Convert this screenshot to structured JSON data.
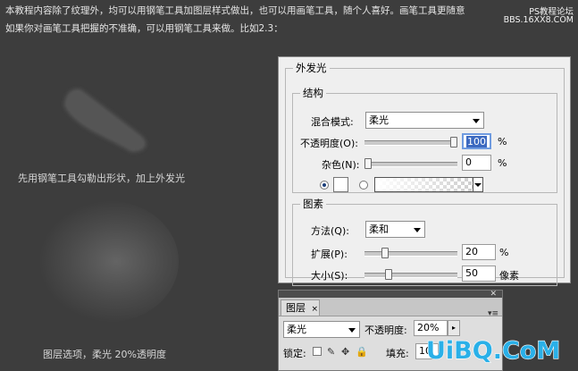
{
  "intro": {
    "line1": "本教程内容除了纹理外，均可以用钢笔工具加图层样式做出，也可以用画笔工具，随个人喜好。画笔工具更随意",
    "line2": "如果你对画笔工具把握的不准确，可以用钢笔工具来做。比如2.3："
  },
  "watermark": {
    "line1": "PS教程论坛",
    "line2": "BBS.16XX8.COM"
  },
  "captions": {
    "shape": "先用钢笔工具勾勒出形状，加上外发光",
    "layer": "图层选项，柔光 20%透明度"
  },
  "outer_glow": {
    "title": "外发光",
    "structure": {
      "legend": "结构",
      "blend_label": "混合模式:",
      "blend_value": "柔光",
      "opacity_label": "不透明度(O):",
      "opacity_value": "100",
      "opacity_unit": "%",
      "opacity_fraction": 1.0,
      "noise_label": "杂色(N):",
      "noise_value": "0",
      "noise_unit": "%",
      "noise_fraction": 0.0
    },
    "elements": {
      "legend": "图素",
      "method_label": "方法(Q):",
      "method_value": "柔和",
      "spread_label": "扩展(P):",
      "spread_value": "20",
      "spread_unit": "%",
      "spread_fraction": 0.2,
      "size_label": "大小(S):",
      "size_value": "50",
      "size_unit": "像素"
    }
  },
  "layers_panel": {
    "tab": "图层",
    "tab_close": "×",
    "menu": "▾≡",
    "blend_value": "柔光",
    "opacity_label": "不透明度:",
    "opacity_value": "20%",
    "lock_label": "锁定:",
    "fill_label": "填充:",
    "fill_value": "10"
  },
  "brand_logo": "UiBQ.CoM",
  "colors": {
    "background": "#3d3d3d",
    "panel": "#efefef",
    "logo": "#2ab0e8"
  }
}
